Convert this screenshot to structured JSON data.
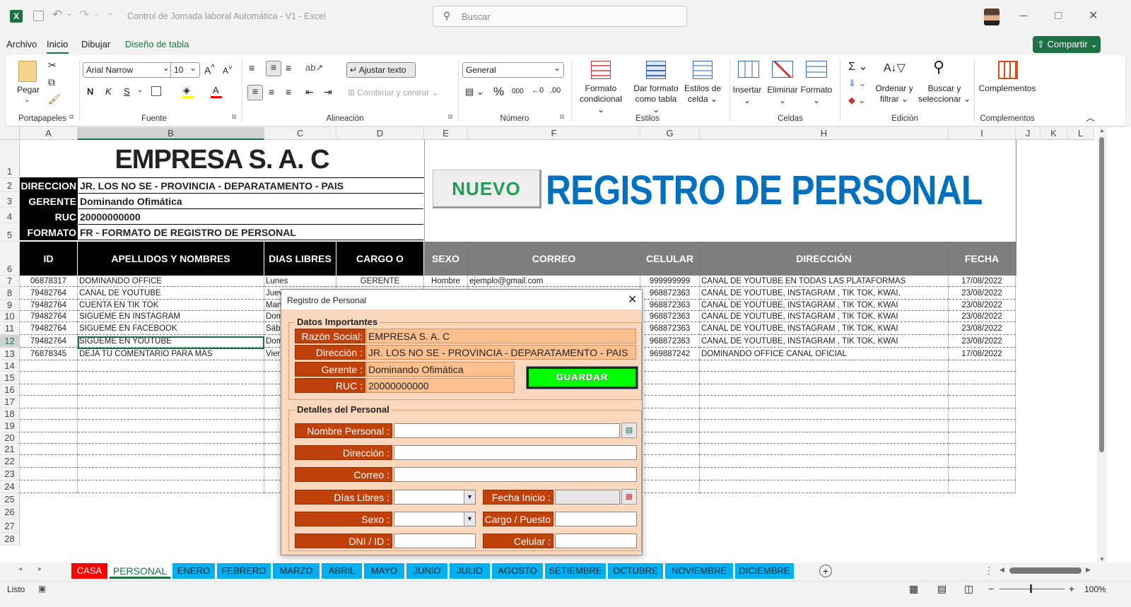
{
  "window": {
    "title": "Control de Jornada laboral Automática - V1  -  Excel",
    "search_placeholder": "Buscar",
    "share_label": "Compartir"
  },
  "menu": [
    "Archivo",
    "Inicio",
    "Dibujar",
    "Diseño de tabla"
  ],
  "ribbon": {
    "clipboard": {
      "paste": "Pegar",
      "group": "Portapapeles"
    },
    "font": {
      "name": "Arial Narrow",
      "size": "10",
      "bold": "N",
      "italic": "K",
      "underline": "S",
      "group": "Fuente"
    },
    "alignment": {
      "wrap": "Ajustar texto",
      "merge": "Combinar y centrar",
      "group": "Alineación"
    },
    "number": {
      "format": "General",
      "group": "Número",
      "percent": "%",
      "thousands": "000"
    },
    "styles": {
      "cond_line1": "Formato",
      "cond_line2": "condicional",
      "table_line1": "Dar formato",
      "table_line2": "como tabla",
      "cell_line1": "Estilos de",
      "cell_line2": "celda",
      "group": "Estilos"
    },
    "cells": {
      "insert": "Insertar",
      "delete": "Eliminar",
      "format": "Formato",
      "group": "Celdas"
    },
    "editing": {
      "sort_line1": "Ordenar y",
      "sort_line2": "filtrar",
      "find_line1": "Buscar y",
      "find_line2": "seleccionar",
      "group": "Edición"
    },
    "addins": {
      "label": "Complementos",
      "group": "Complementos"
    }
  },
  "columns": [
    "A",
    "B",
    "C",
    "D",
    "E",
    "F",
    "G",
    "H",
    "I",
    "J",
    "K",
    "L"
  ],
  "rows": [
    "1",
    "2",
    "3",
    "4",
    "5",
    "6",
    "7",
    "8",
    "9",
    "10",
    "11",
    "12",
    "13",
    "14",
    "15",
    "16",
    "17",
    "18",
    "19",
    "20",
    "21",
    "22",
    "23",
    "24",
    "25",
    "26",
    "27",
    "28"
  ],
  "sheet": {
    "company": "EMPRESA S. A. C",
    "info": [
      {
        "label": "DIRECCION",
        "value": "JR. LOS NO SE - PROVINCIA - DEPARATAMENTO - PAIS"
      },
      {
        "label": "GERENTE",
        "value": "Dominando Ofimática"
      },
      {
        "label": "RUC",
        "value": "20000000000"
      },
      {
        "label": "FORMATO",
        "value": "FR - FORMATO DE REGISTRO DE PERSONAL"
      }
    ],
    "badge": "NUEVO",
    "title": "REGISTRO DE PERSONAL",
    "headers": [
      "ID",
      "APELLIDOS Y NOMBRES",
      "DIAS LIBRES",
      "CARGO O PUESTO",
      "SEXO",
      "CORREO",
      "CELULAR",
      "DIRECCIÓN",
      "FECHA INICIO"
    ],
    "data": [
      [
        "06878317",
        "DOMINANDO OFFICE",
        "Lunes",
        "GERENTE",
        "Hombre",
        "ejemplo@gmail.com",
        "999999999",
        "CANAL DE YOUTUBE EN TODAS LAS PLATAFORMAS",
        "17/08/2022"
      ],
      [
        "79482764",
        "CANAL DE YOUTUBE",
        "Juev",
        "",
        "",
        "",
        "968872363",
        "CANAL DE YOUTUBE, INSTAGRAM , TIK TOK, KWAI,",
        "23/08/2022"
      ],
      [
        "79482764",
        "CUENTA EN TIK TOK",
        "Mart",
        "",
        "",
        "",
        "968872363",
        "CANAL DE YOUTUBE, INSTAGRAM , TIK TOK, KWAI",
        "23/08/2022"
      ],
      [
        "79482764",
        "SIGUEME EN INSTAGRAM",
        "Dom",
        "",
        "",
        "",
        "968872363",
        "CANAL DE YOUTUBE, INSTAGRAM , TIK TOK, KWAI",
        "23/08/2022"
      ],
      [
        "79482764",
        "SIGUEME EN FACEBOOK",
        "Sába",
        "",
        "",
        "",
        "968872363",
        "CANAL DE YOUTUBE, INSTAGRAM , TIK TOK, KWAI",
        "23/08/2022"
      ],
      [
        "79482764",
        "SIGUEME EN YOUTUBE",
        "Dom",
        "",
        "",
        "",
        "968872363",
        "CANAL DE YOUTUBE, INSTAGRAM , TIK TOK, KWAI",
        "23/08/2022"
      ],
      [
        "76878345",
        "DEJA TU COMENTARIO PARA MÁS",
        "Vierr",
        "",
        "",
        "",
        "969887242",
        "DOMINANDO OFFICE CANAL OFICIAL",
        "17/08/2022"
      ]
    ]
  },
  "dialog": {
    "title": "Registro de Personal",
    "section1": "Datos Importantes",
    "razon_label": "Razón Social:",
    "razon_value": "EMPRESA S. A. C",
    "direccion_label": "Dirección :",
    "direccion_value": "JR. LOS NO SE - PROVINCIA - DEPARATAMENTO - PAIS",
    "gerente_label": "Gerente :",
    "gerente_value": "Dominando Ofimática",
    "ruc_label": "RUC :",
    "ruc_value": "20000000000",
    "save_label": "GUARDAR",
    "section2": "Detalles del Personal",
    "nombre_label": "Nombre Personal :",
    "dir_label": "Dirección :",
    "correo_label": "Correo :",
    "dias_label": "Días Libres :",
    "fecha_label": "Fecha Inicio :",
    "sexo_label": "Sexo :",
    "cargo_label": "Cargo / Puesto",
    "dni_label": "DNI / ID :",
    "celular_label": "Celular :"
  },
  "tabs": [
    {
      "label": "CASA",
      "color": "#ff0000",
      "text": "#ffffff"
    },
    {
      "label": "PERSONAL",
      "color": "#ffffff",
      "text": "#1e7145"
    },
    {
      "label": "ENERO",
      "color": "#00b0f0",
      "text": "#222222"
    },
    {
      "label": "FEBRERO",
      "color": "#00b0f0",
      "text": "#222222"
    },
    {
      "label": "MARZO",
      "color": "#00b0f0",
      "text": "#222222"
    },
    {
      "label": "ABRIL",
      "color": "#00b0f0",
      "text": "#222222"
    },
    {
      "label": "MAYO",
      "color": "#00b0f0",
      "text": "#222222"
    },
    {
      "label": "JUNIO",
      "color": "#00b0f0",
      "text": "#222222"
    },
    {
      "label": "JULIO",
      "color": "#00b0f0",
      "text": "#222222"
    },
    {
      "label": "AGOSTO",
      "color": "#00b0f0",
      "text": "#222222"
    },
    {
      "label": "SETIEMBRE",
      "color": "#00b0f0",
      "text": "#222222"
    },
    {
      "label": "OCTUBRE",
      "color": "#00b0f0",
      "text": "#222222"
    },
    {
      "label": "NOVIEMBRE",
      "color": "#00b0f0",
      "text": "#222222"
    },
    {
      "label": "DICIEMBRE",
      "color": "#00b0f0",
      "text": "#222222"
    }
  ],
  "status": {
    "ready": "Listo",
    "zoom": "100%"
  },
  "colors": {
    "excel_green": "#1e7145",
    "header_black": "#000000",
    "header_gray": "#7f7f7f",
    "title_blue": "#0070c0",
    "badge_green": "#1e9e50",
    "dialog_orange": "#c0420a",
    "save_green": "#00ff00"
  }
}
